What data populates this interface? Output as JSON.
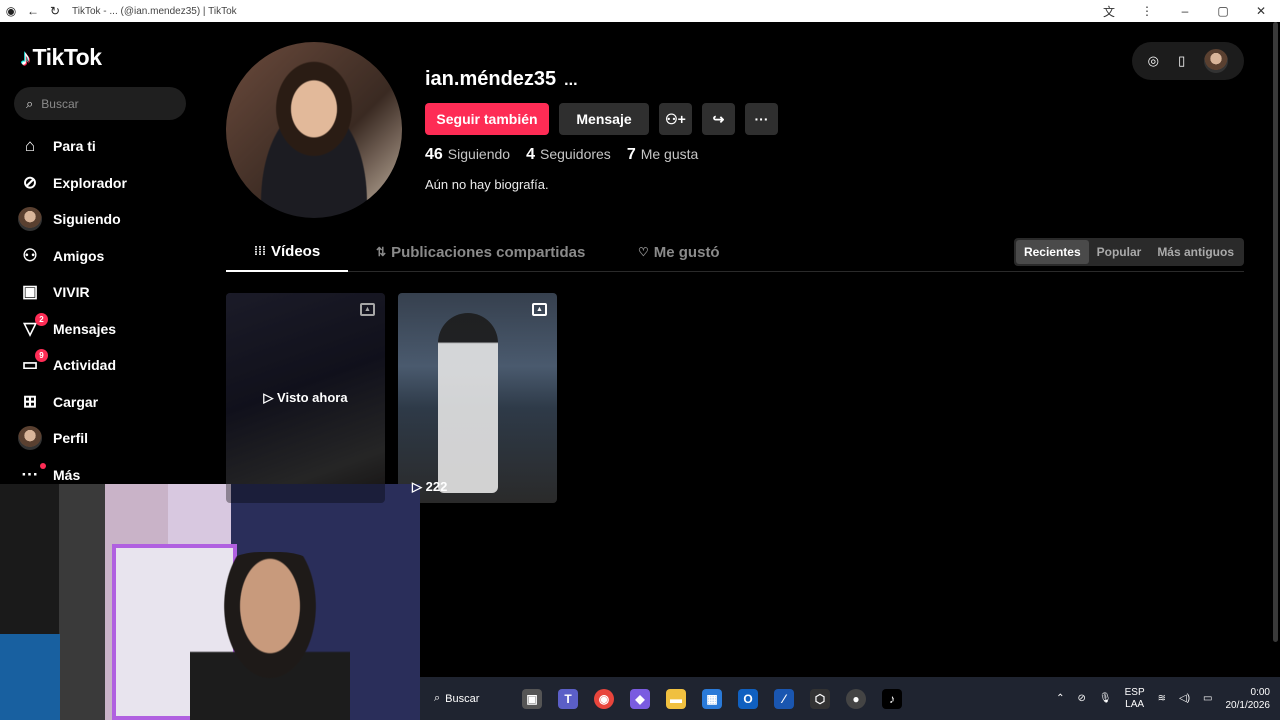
{
  "window": {
    "title": "TikTok - ... (@ian.mendez35) | TikTok"
  },
  "sidebar": {
    "logo": "TikTok",
    "search_placeholder": "Buscar",
    "items": [
      {
        "label": "Para ti",
        "icon": "home-icon"
      },
      {
        "label": "Explorador",
        "icon": "compass-icon"
      },
      {
        "label": "Siguiendo",
        "icon": "avatar"
      },
      {
        "label": "Amigos",
        "icon": "friends-icon"
      },
      {
        "label": "VIVIR",
        "icon": "live-icon"
      },
      {
        "label": "Mensajes",
        "icon": "send-icon",
        "badge": "2"
      },
      {
        "label": "Actividad",
        "icon": "inbox-icon",
        "badge": "9"
      },
      {
        "label": "Cargar",
        "icon": "plus-icon"
      },
      {
        "label": "Perfil",
        "icon": "avatar"
      },
      {
        "label": "Más",
        "icon": "more-icon"
      }
    ]
  },
  "profile": {
    "username": "ian.méndez35",
    "more": "...",
    "follow_label": "Seguir también",
    "message_label": "Mensaje",
    "stats": {
      "following_count": "46",
      "following_label": "Siguiendo",
      "followers_count": "4",
      "followers_label": "Seguidores",
      "likes_count": "7",
      "likes_label": "Me gusta"
    },
    "bio": "Aún no hay biografía."
  },
  "tabs": [
    {
      "label": "Vídeos",
      "active": true
    },
    {
      "label": "Publicaciones compartidas",
      "active": false
    },
    {
      "label": "Me gustó",
      "active": false
    }
  ],
  "sort": {
    "options": [
      "Recientes",
      "Popular",
      "Más antiguos"
    ],
    "selected": "Recientes"
  },
  "videos": [
    {
      "overlay": "▷ Visto ahora",
      "views": ""
    },
    {
      "overlay": "",
      "views": "222"
    }
  ],
  "taskbar": {
    "search_label": "Buscar",
    "lang_top": "ESP",
    "lang_bottom": "LAA",
    "time": "0:00",
    "date": "20/1/2026"
  }
}
